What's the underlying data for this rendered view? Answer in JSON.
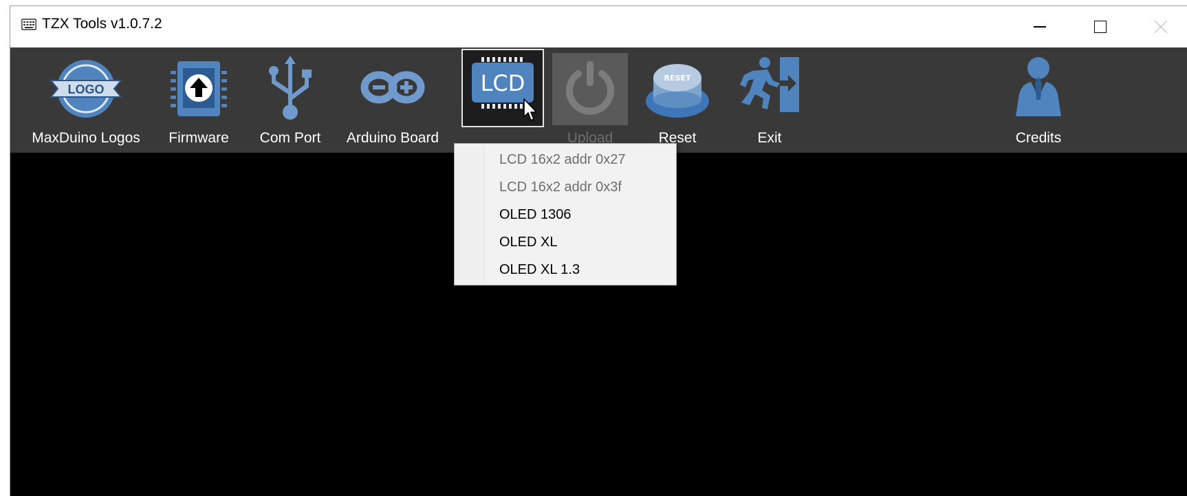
{
  "window": {
    "title": "TZX Tools v1.0.7.2",
    "controls": {
      "minimize_icon": "minimize-icon",
      "maximize_icon": "maximize-icon",
      "close_icon": "close-icon"
    }
  },
  "toolbar": {
    "items": [
      {
        "label": "MaxDuino Logos",
        "icon": "logo-badge-icon",
        "state": "normal",
        "icon_text": "LOGO"
      },
      {
        "label": "Firmware",
        "icon": "chip-upload-icon",
        "state": "normal"
      },
      {
        "label": "Com Port",
        "icon": "usb-icon",
        "state": "normal"
      },
      {
        "label": "Arduino Board",
        "icon": "arduino-infinity-icon",
        "state": "normal"
      },
      {
        "label": "",
        "icon": "lcd-chip-icon",
        "state": "selected",
        "icon_text": "LCD"
      },
      {
        "label": "Upload",
        "icon": "power-icon",
        "state": "disabled"
      },
      {
        "label": "Reset",
        "icon": "reset-button-icon",
        "state": "normal",
        "icon_text": "RESET"
      },
      {
        "label": "Exit",
        "icon": "exit-running-man-icon",
        "state": "normal"
      },
      {
        "label": "Credits",
        "icon": "praying-person-icon",
        "state": "normal"
      }
    ]
  },
  "lcd_menu": {
    "items": [
      {
        "label": "LCD 16x2 addr 0x27",
        "enabled": false
      },
      {
        "label": "LCD 16x2 addr 0x3f",
        "enabled": false
      },
      {
        "label": "OLED 1306",
        "enabled": true
      },
      {
        "label": "OLED XL",
        "enabled": true
      },
      {
        "label": "OLED XL 1.3",
        "enabled": true
      }
    ]
  },
  "colors": {
    "toolbar_bg": "#393939",
    "icon_blue": "#4f84bf",
    "viewport_bg": "#000000",
    "menu_bg": "#f2f2f2"
  }
}
